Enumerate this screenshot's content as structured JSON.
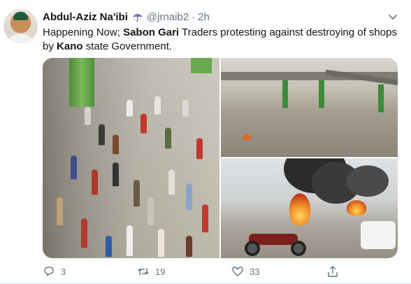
{
  "tweet": {
    "author": {
      "display_name": "Abdul-Aziz Na'ibi",
      "badge_icon": "umbrella-icon",
      "handle": "@jrnaib2",
      "separator": "·",
      "time": "2h"
    },
    "text": {
      "part1": "Happening Now; ",
      "bold1": "Sabon Gari",
      "part2": " Traders protesting against destroying of shops by ",
      "bold2": "Kano",
      "part3": " state Government."
    },
    "actions": {
      "reply": {
        "icon": "reply-icon",
        "count": "3"
      },
      "retweet": {
        "icon": "retweet-icon",
        "count": "19"
      },
      "like": {
        "icon": "like-icon",
        "count": "33"
      },
      "share": {
        "icon": "share-icon"
      }
    },
    "colors": {
      "text_primary": "#14171a",
      "text_secondary": "#657786",
      "brand": "#1da1f2"
    }
  }
}
